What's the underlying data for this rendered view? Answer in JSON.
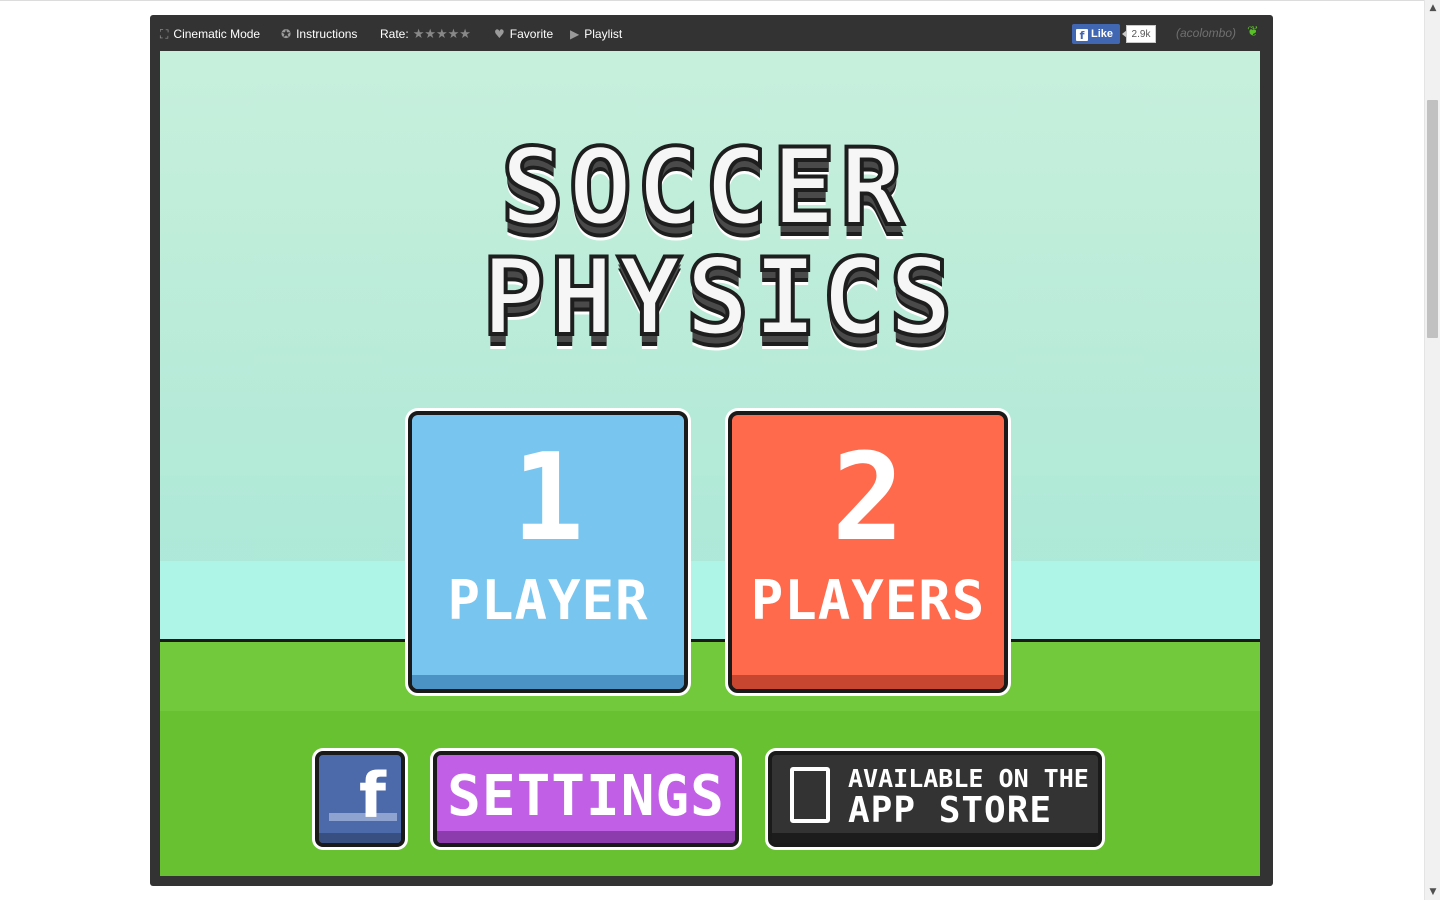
{
  "toolbar": {
    "cinematic_label": "Cinematic Mode",
    "instructions_label": "Instructions",
    "rate_label": "Rate:",
    "rate_stars": "★★★★★",
    "favorite_label": "Favorite",
    "playlist_label": "Playlist",
    "fb_like_label": "Like",
    "fb_like_count": "2.9k",
    "author": "(acolombo)"
  },
  "game": {
    "title_line1": "SOCCER",
    "title_line2": "PHYSICS",
    "one_player": {
      "number": "1",
      "label": "PLAYER"
    },
    "two_players": {
      "number": "2",
      "label": "PLAYERS"
    },
    "facebook_glyph": "f",
    "settings_label": "SETTINGS",
    "appstore_line1": "AVAILABLE ON THE",
    "appstore_line2": "APP STORE"
  },
  "colors": {
    "one_player_button": "#78c5ef",
    "two_players_button": "#ff6a4d",
    "settings_button": "#c160e6",
    "facebook_button": "#4c6aa9",
    "appstore_button": "#333333",
    "grass": "#71c93b"
  },
  "icons": {
    "cinematic": "fullscreen-icon",
    "instructions": "help-icon",
    "favorite": "heart-icon",
    "playlist": "play-icon",
    "author": "leaf-icon",
    "appstore": "tablet-icon"
  }
}
